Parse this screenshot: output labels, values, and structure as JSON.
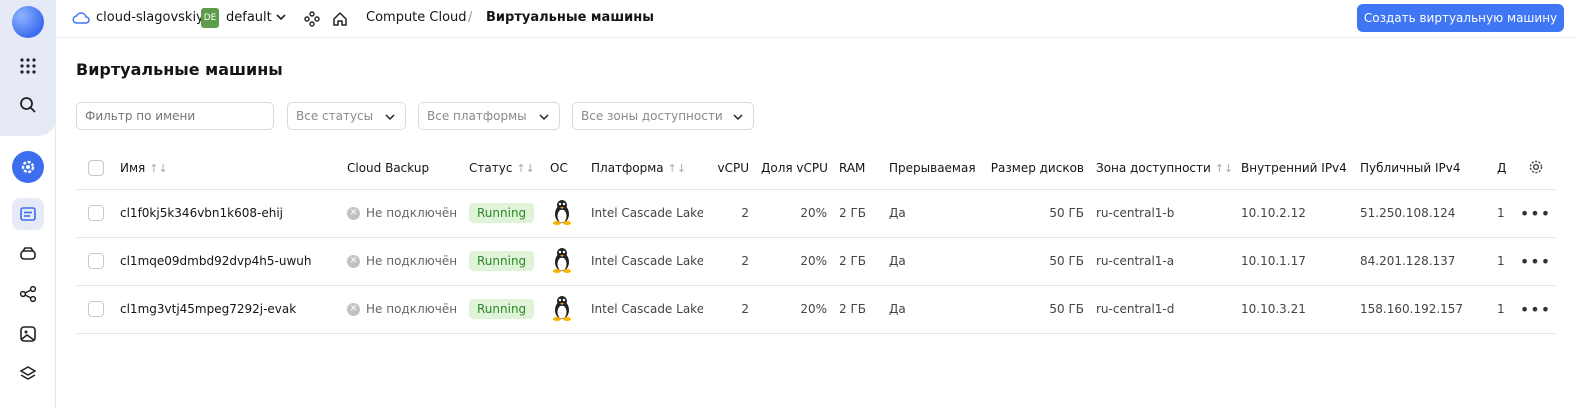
{
  "header": {
    "cloud_name": "cloud-slagovskiy",
    "folder_badge": "DE",
    "folder_name": "default",
    "breadcrumb_service": "Compute Cloud",
    "breadcrumb_separator": "/",
    "breadcrumb_page": "Виртуальные машины",
    "create_button": "Создать виртуальную машину"
  },
  "page": {
    "title": "Виртуальные машины"
  },
  "filters": {
    "name_placeholder": "Фильтр по имени",
    "status": "Все статусы",
    "platform": "Все платформы",
    "zone": "Все зоны доступности"
  },
  "table": {
    "columns": {
      "name": "Имя",
      "backup": "Cloud Backup",
      "status": "Статус",
      "os": "ОС",
      "platform": "Платформа",
      "vcpu": "vCPU",
      "vcpu_share": "Доля vCPU",
      "ram": "RAM",
      "preemptible": "Прерываемая",
      "disk_size": "Размер дисков",
      "zone": "Зона доступности",
      "internal_ip": "Внутренний IPv4",
      "public_ip": "Публичный IPv4",
      "extra": "Д"
    },
    "rows": [
      {
        "name": "cl1f0kj5k346vbn1k608-ehij",
        "backup": "Не подключён",
        "status": "Running",
        "platform": "Intel Cascade Lake",
        "vcpu": "2",
        "vcpu_share": "20%",
        "ram": "2 ГБ",
        "preemptible": "Да",
        "disk_size": "50 ГБ",
        "zone": "ru-central1-b",
        "internal_ip": "10.10.2.12",
        "public_ip": "51.250.108.124",
        "extra": "1"
      },
      {
        "name": "cl1mqe09dmbd92dvp4h5-uwuh",
        "backup": "Не подключён",
        "status": "Running",
        "platform": "Intel Cascade Lake",
        "vcpu": "2",
        "vcpu_share": "20%",
        "ram": "2 ГБ",
        "preemptible": "Да",
        "disk_size": "50 ГБ",
        "zone": "ru-central1-a",
        "internal_ip": "10.10.1.17",
        "public_ip": "84.201.128.137",
        "extra": "1"
      },
      {
        "name": "cl1mg3vtj45mpeg7292j-evak",
        "backup": "Не подключён",
        "status": "Running",
        "platform": "Intel Cascade Lake",
        "vcpu": "2",
        "vcpu_share": "20%",
        "ram": "2 ГБ",
        "preemptible": "Да",
        "disk_size": "50 ГБ",
        "zone": "ru-central1-d",
        "internal_ip": "10.10.3.21",
        "public_ip": "158.160.192.157",
        "extra": "1"
      }
    ]
  },
  "colors": {
    "accent": "#3f76f3",
    "running_bg": "#dff3d8",
    "running_text": "#2f8a2b",
    "folder_badge": "#5c9c4a"
  }
}
